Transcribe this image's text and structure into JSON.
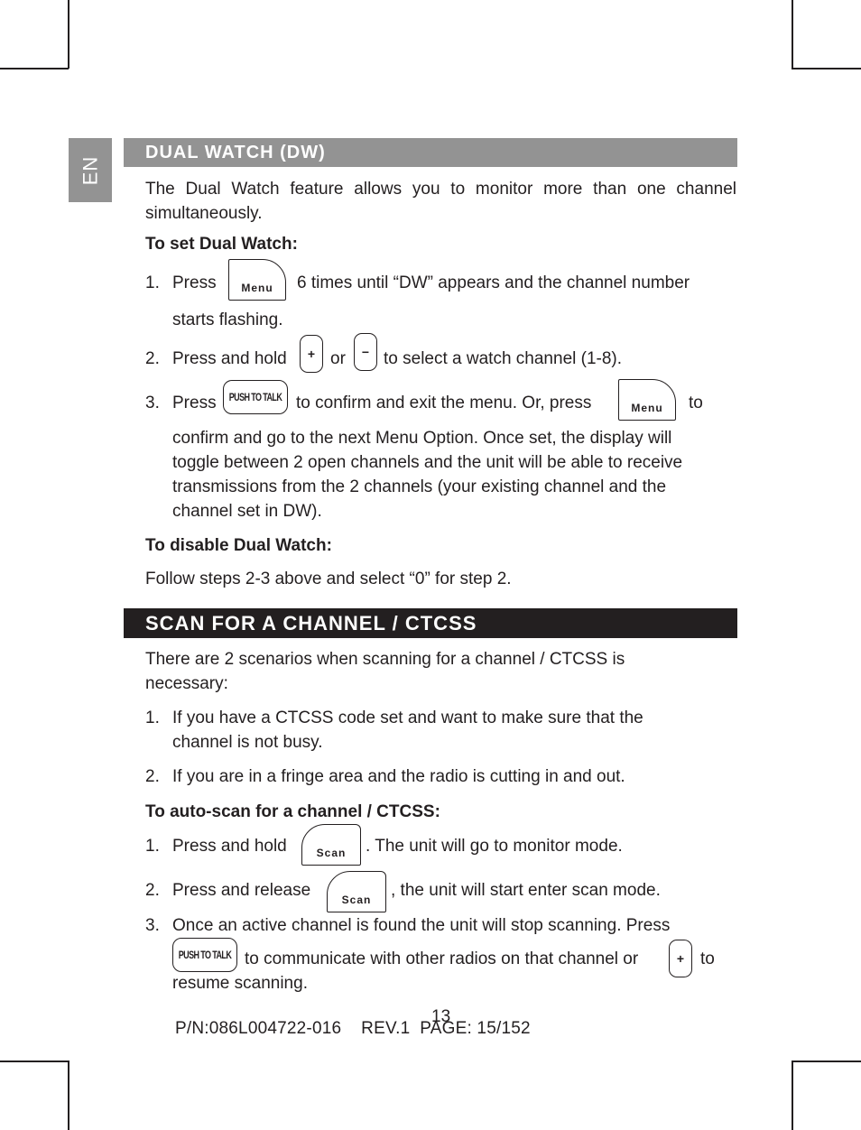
{
  "language_tab": "EN",
  "dual_watch": {
    "heading": "DUAL WATCH (DW)",
    "intro_line1": "The Dual Watch feature allows you to monitor more than one channel",
    "intro_line2": "simultaneously.",
    "set_heading": "To set Dual Watch:",
    "steps": [
      {
        "num": "1.",
        "pre": "Press",
        "key1": "Menu",
        "post": "6 times until “DW” appears and the channel number",
        "cont": "starts flashing."
      },
      {
        "num": "2.",
        "pre": "Press and hold",
        "key1": "+",
        "mid": "or",
        "key2": "−",
        "post": "to select a watch channel (1-8)."
      },
      {
        "num": "3.",
        "pre": "Press",
        "key1": "PUSH TO TALK",
        "mid": "to confirm and exit the menu. Or, press",
        "key2": "Menu",
        "post": "to",
        "cont_lines": [
          "confirm and go to the next Menu Option. Once set, the display will",
          "toggle between 2 open channels and the unit will be able to receive",
          "transmissions from the 2 channels (your existing channel and the",
          "channel set in DW)."
        ]
      }
    ],
    "disable_heading": "To disable Dual Watch:",
    "disable_text": "Follow steps 2-3 above and select “0” for step 2."
  },
  "scan": {
    "heading": "SCAN FOR A CHANNEL / CTCSS",
    "intro_line1": "There are 2 scenarios when scanning for a channel / CTCSS is",
    "intro_line2": "necessary:",
    "scenarios": [
      {
        "num": "1.",
        "line1": "If you have a CTCSS code set and want to make sure that the",
        "line2": "channel is not busy."
      },
      {
        "num": "2.",
        "line1": "If you are in a fringe area and the radio is cutting in and out."
      }
    ],
    "auto_heading": "To auto-scan for a channel / CTCSS:",
    "steps": [
      {
        "num": "1.",
        "pre": "Press and hold",
        "key1": "Scan",
        "post": ". The unit will go to monitor mode."
      },
      {
        "num": "2.",
        "pre": "Press and release",
        "key1": "Scan",
        "post": ", the unit will start enter scan mode."
      },
      {
        "num": "3.",
        "line1": "Once an active channel is found the unit will stop scanning. Press",
        "key1": "PUSH TO TALK",
        "mid": "to communicate with other radios on that channel or",
        "key2": "+",
        "post": "to",
        "line3": "resume scanning."
      }
    ]
  },
  "footer": {
    "part_number": "P/N:086L004722-016    REV.1  PAGE: 15/152",
    "page_number": "13"
  }
}
